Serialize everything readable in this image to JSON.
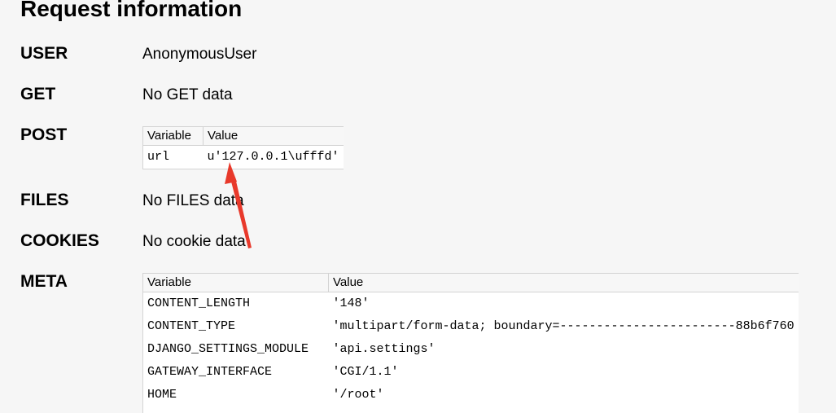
{
  "page": {
    "title": "Request information"
  },
  "sections": {
    "user": {
      "label": "USER",
      "value": "AnonymousUser"
    },
    "get": {
      "label": "GET",
      "value": "No GET data"
    },
    "post": {
      "label": "POST",
      "columns": [
        "Variable",
        "Value"
      ],
      "rows": [
        {
          "variable": "url",
          "value": "u'127.0.0.1\\ufffd'"
        }
      ]
    },
    "files": {
      "label": "FILES",
      "value": "No FILES data"
    },
    "cookies": {
      "label": "COOKIES",
      "value": "No cookie data"
    },
    "meta": {
      "label": "META",
      "columns": [
        "Variable",
        "Value"
      ],
      "rows": [
        {
          "variable": "CONTENT_LENGTH",
          "value": "'148'"
        },
        {
          "variable": "CONTENT_TYPE",
          "value": "'multipart/form-data; boundary=------------------------88b6f760"
        },
        {
          "variable": "DJANGO_SETTINGS_MODULE",
          "value": "'api.settings'"
        },
        {
          "variable": "GATEWAY_INTERFACE",
          "value": "'CGI/1.1'"
        },
        {
          "variable": "HOME",
          "value": "'/root'"
        },
        {
          "variable": "",
          "value": ""
        }
      ]
    }
  },
  "annotation": {
    "arrow_color": "#e8392b"
  }
}
